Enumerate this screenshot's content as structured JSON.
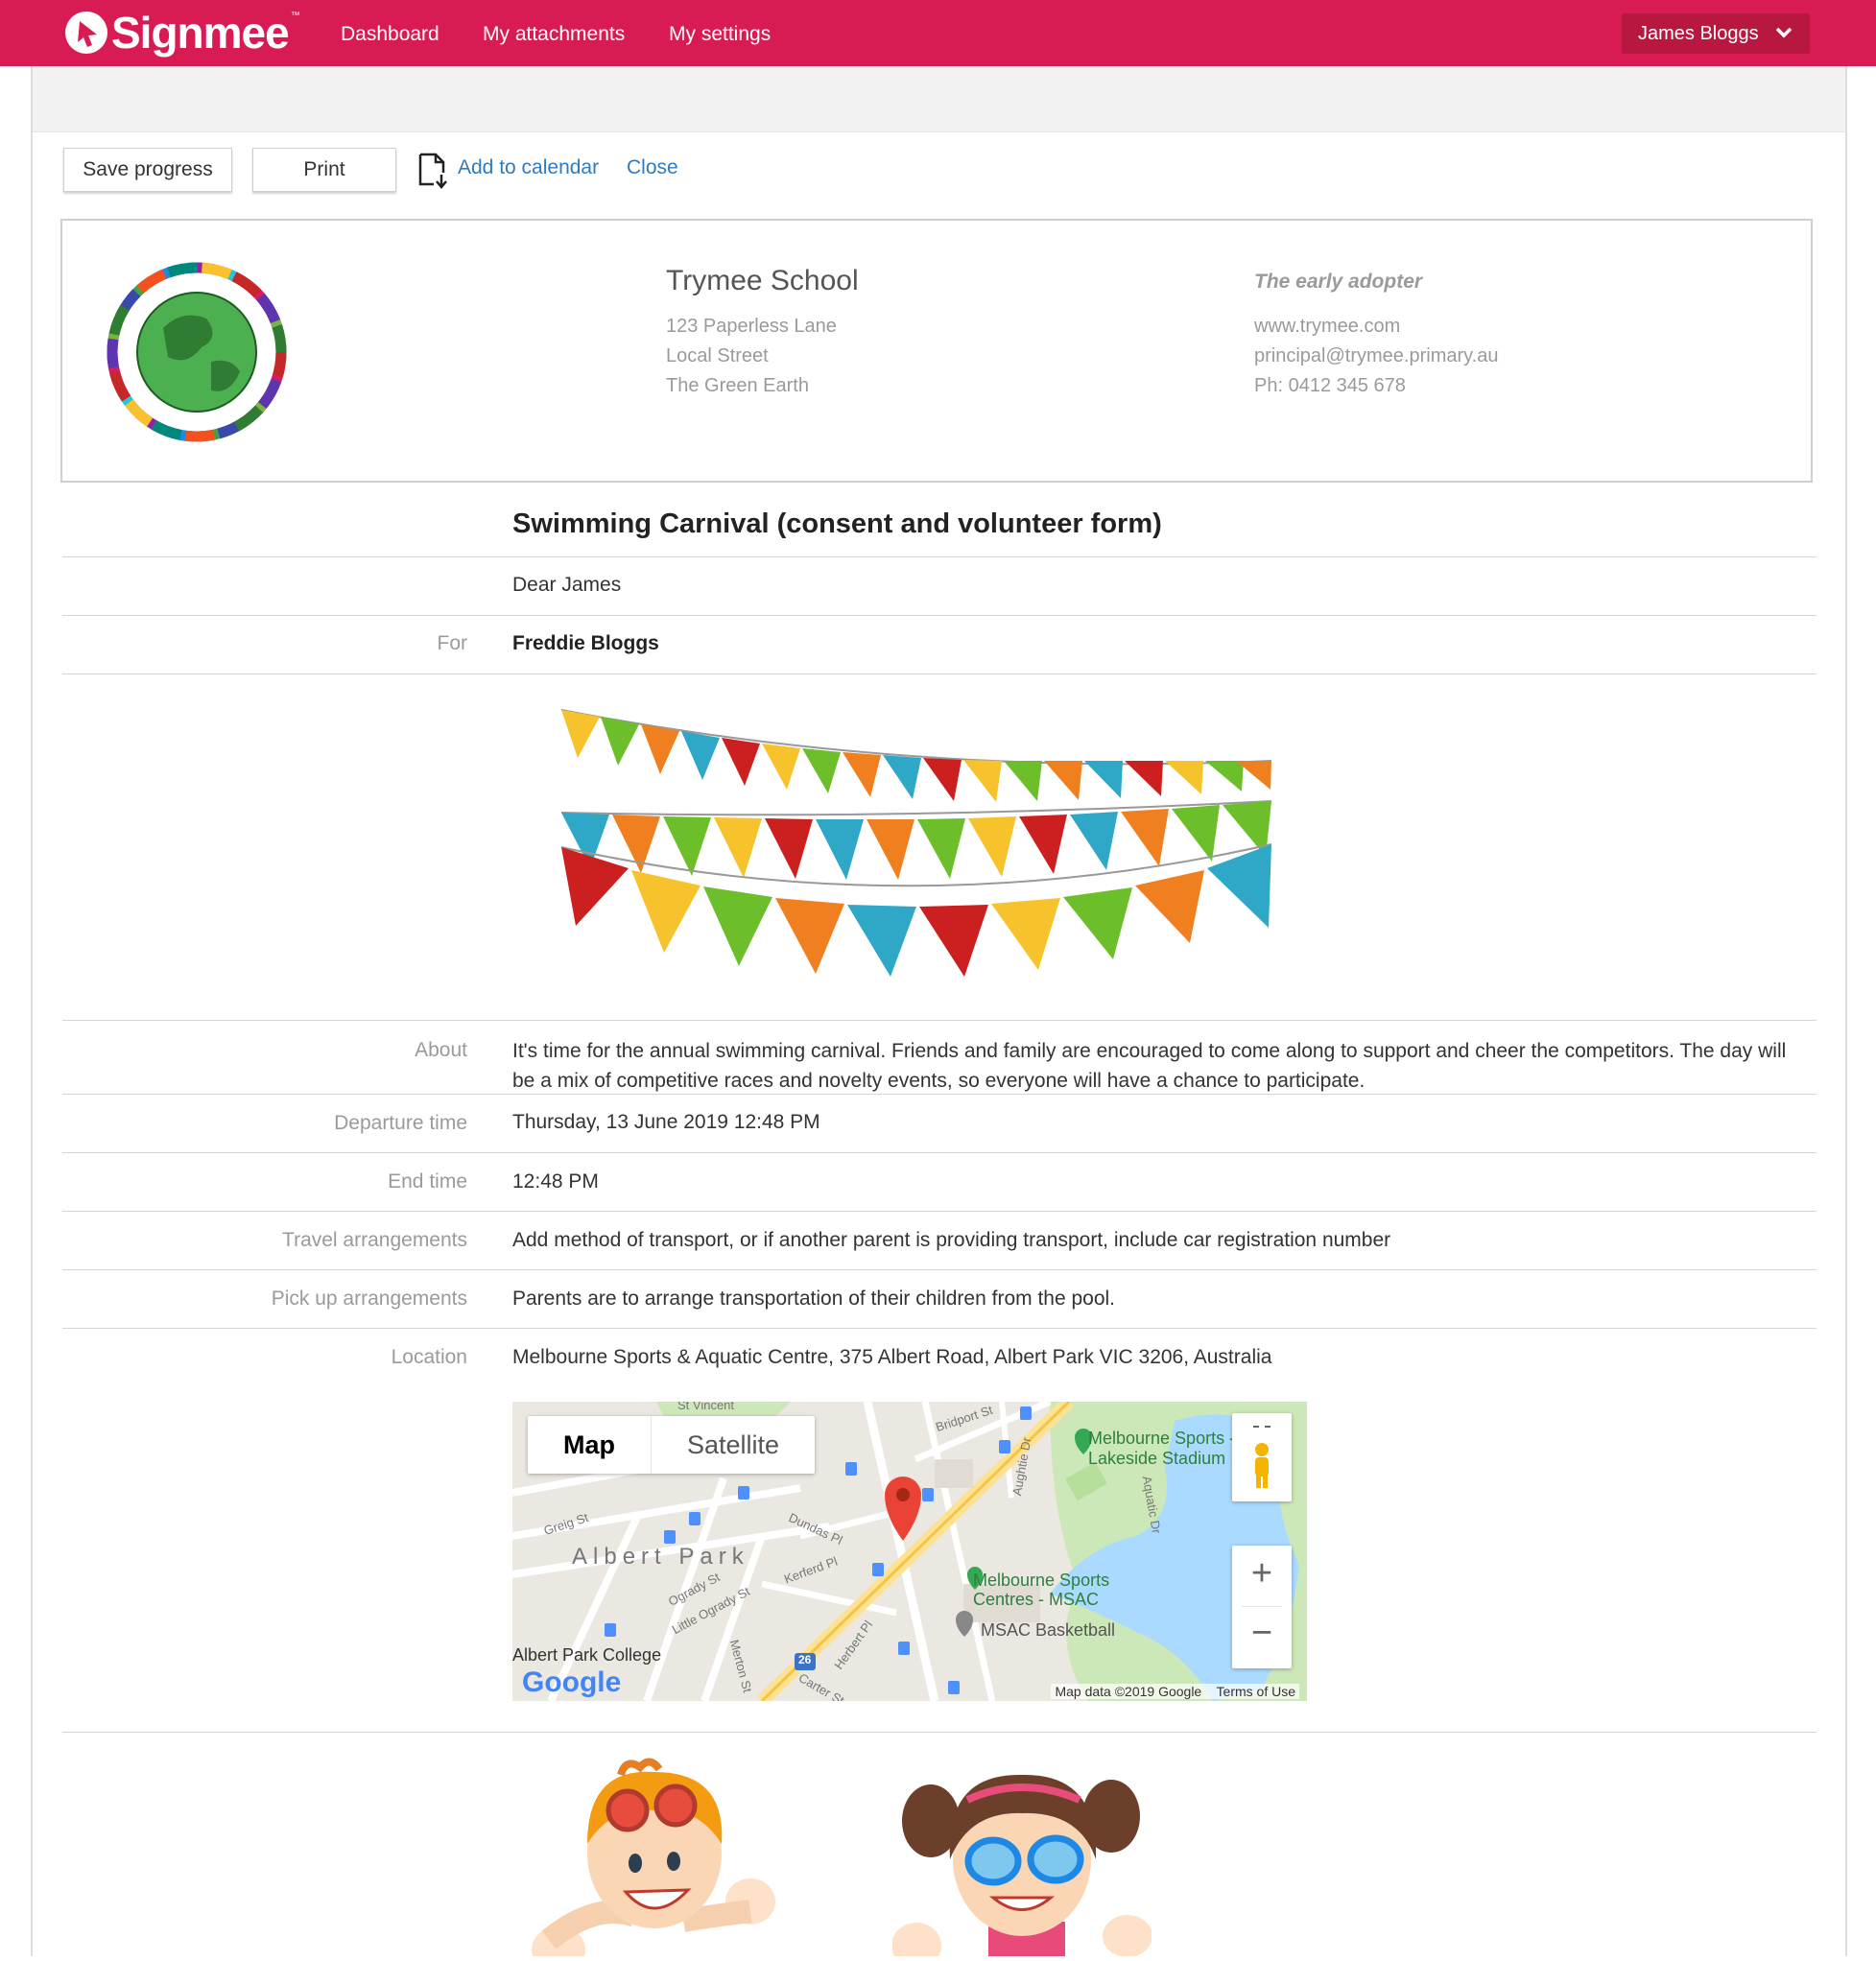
{
  "nav": {
    "brand": "Signmee",
    "brand_tm": "™",
    "links": [
      "Dashboard",
      "My attachments",
      "My settings"
    ],
    "user": "James Bloggs"
  },
  "toolbar": {
    "save_label": "Save progress",
    "print_label": "Print",
    "calendar_label": "Add to calendar",
    "close_label": "Close"
  },
  "school": {
    "name": "Trymee School",
    "address": [
      "123 Paperless Lane",
      "Local Street",
      "The Green Earth"
    ],
    "tagline": "The early adopter",
    "contact": [
      "www.trymee.com",
      "principal@trymee.primary.au",
      "Ph: 0412 345 678"
    ]
  },
  "form": {
    "title": "Swimming Carnival (consent and volunteer form)",
    "greeting": "Dear James",
    "for_label": "For",
    "for_value": "Freddie Bloggs",
    "about_label": "About",
    "about_value": "It's time for the annual swimming carnival. Friends and family are encouraged to come along to support and cheer the competitors.  The day will be a mix of competitive races and novelty events, so everyone will have a chance to participate.",
    "departure_label": "Departure time",
    "departure_value": "Thursday, 13 June 2019 12:48 PM",
    "end_label": "End time",
    "end_value": "12:48 PM",
    "travel_label": "Travel arrangements",
    "travel_value": "Add method of transport, or if another parent is providing transport, include car registration number",
    "pickup_label": "Pick up arrangements",
    "pickup_value": "Parents are to arrange transportation of their children from the pool.",
    "location_label": "Location",
    "location_value": "Melbourne Sports & Aquatic Centre, 375 Albert Road, Albert Park VIC 3206, Australia"
  },
  "map": {
    "map_tab": "Map",
    "satellite_tab": "Satellite",
    "zoom_in": "+",
    "zoom_out": "−",
    "places": [
      "Melbourne Sports Centres - MSAC",
      "MSAC Basketball",
      "Melbourne Sports - Lakeside Stadium",
      "Albert Park College"
    ],
    "streets": [
      "St Vincent",
      "Bridport St",
      "Dundas Pl",
      "Kerferd Pl",
      "Ogrady St",
      "Little Ogrady St",
      "Greig St",
      "Merton St",
      "Herbert Pl",
      "Carter St",
      "Aughtie Dr",
      "Aquatic Dr"
    ],
    "suburb": "Albert Park",
    "route_badge": "26",
    "attribution": "Map data ©2019 Google",
    "terms": "Terms of Use",
    "google": "Google"
  },
  "colors": {
    "brand": "#d81b52",
    "link": "#2f7bbf",
    "water": "#aadaff"
  }
}
